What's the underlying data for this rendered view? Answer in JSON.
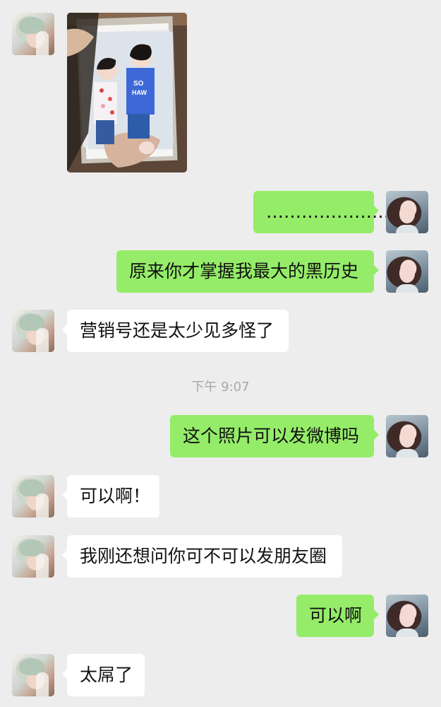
{
  "chat": {
    "timestamp": "下午 9:07",
    "messages": [
      {
        "side": "left",
        "type": "image"
      },
      {
        "side": "right",
        "text": "…………………"
      },
      {
        "side": "right",
        "text": "原来你才掌握我最大的黑历史"
      },
      {
        "side": "left",
        "text": "营销号还是太少见多怪了"
      },
      {
        "side": "right",
        "text": "这个照片可以发微博吗"
      },
      {
        "side": "left",
        "text": "可以啊！"
      },
      {
        "side": "left",
        "text": "我刚还想问你可不可以发朋友圈"
      },
      {
        "side": "right",
        "text": "可以啊"
      },
      {
        "side": "left",
        "text": "太屌了"
      }
    ]
  }
}
